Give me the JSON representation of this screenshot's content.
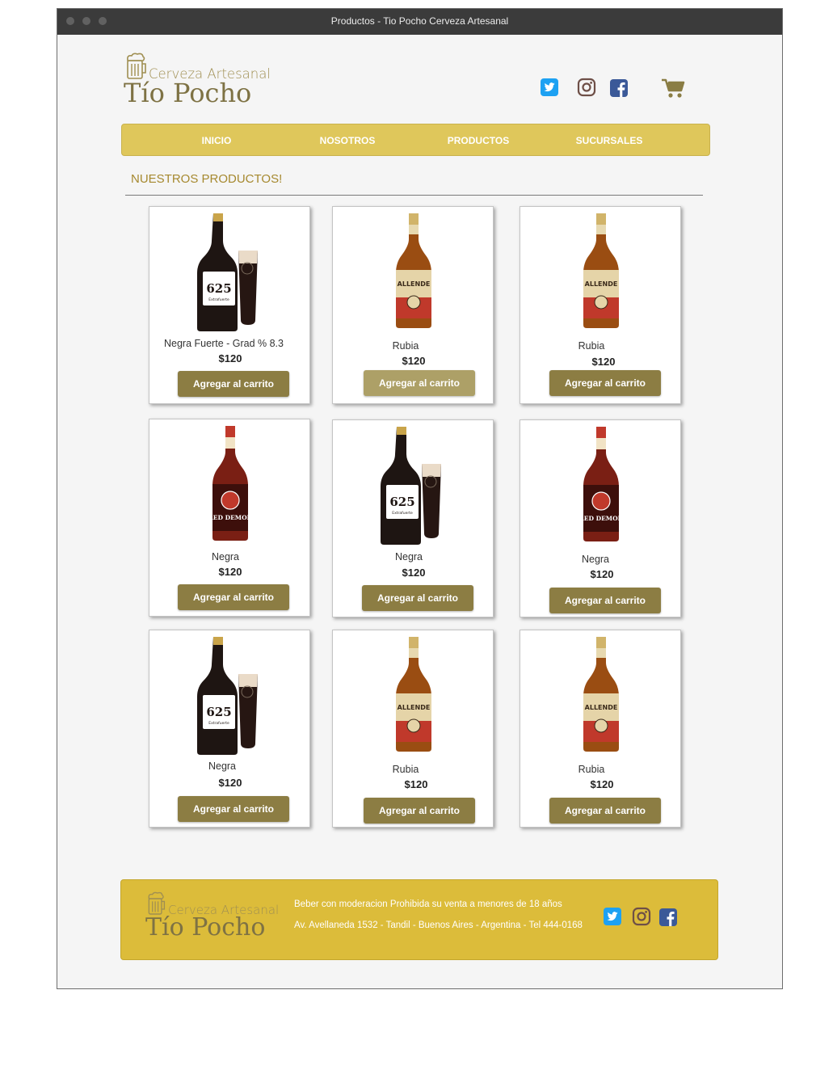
{
  "window": {
    "title": "Productos - Tio Pocho Cerveza Artesanal"
  },
  "brand": {
    "line1": "Cerveza Artesanal",
    "line2": "Tío Pocho"
  },
  "social_icons": [
    "twitter-icon",
    "instagram-icon",
    "facebook-icon",
    "cart-icon"
  ],
  "colors": {
    "nav_bg": "#dfc75b",
    "footer_bg": "#dcbc3a",
    "button": "#8c7d43",
    "twitter": "#1da1f2",
    "instagram": "#6e4f47",
    "facebook": "#3b5998",
    "cart": "#8a7d44"
  },
  "nav": {
    "items": [
      {
        "label": "INICIO"
      },
      {
        "label": "NOSOTROS"
      },
      {
        "label": "PRODUCTOS"
      },
      {
        "label": "SUCURSALES"
      }
    ]
  },
  "section": {
    "title": "NUESTROS PRODUCTOS!"
  },
  "products": [
    {
      "name": "Negra Fuerte - Grad % 8.3",
      "price": "$120",
      "button": "Agregar al carrito",
      "image": "stout-625-bottle-glass"
    },
    {
      "name": "Rubia",
      "price": "$120",
      "button": "Agregar al carrito",
      "image": "allende-amber-bottle"
    },
    {
      "name": "Rubia",
      "price": "$120",
      "button": "Agregar al carrito",
      "image": "allende-amber-bottle"
    },
    {
      "name": "Negra",
      "price": "$120",
      "button": "Agregar al carrito",
      "image": "red-demon-bottle"
    },
    {
      "name": "Negra",
      "price": "$120",
      "button": "Agregar al carrito",
      "image": "stout-625-bottle-glass"
    },
    {
      "name": "Negra",
      "price": "$120",
      "button": "Agregar al carrito",
      "image": "red-demon-bottle"
    },
    {
      "name": "Negra",
      "price": "$120",
      "button": "Agregar al carrito",
      "image": "stout-625-bottle-glass"
    },
    {
      "name": "Rubia",
      "price": "$120",
      "button": "Agregar al carrito",
      "image": "allende-amber-bottle"
    },
    {
      "name": "Rubia",
      "price": "$120",
      "button": "Agregar al carrito",
      "image": "allende-amber-bottle"
    }
  ],
  "footer": {
    "line1": "Beber con moderacion Prohibida su venta a menores de 18 años",
    "line2": "Av. Avellaneda 1532 - Tandil - Buenos Aires - Argentina - Tel 444-0168"
  }
}
